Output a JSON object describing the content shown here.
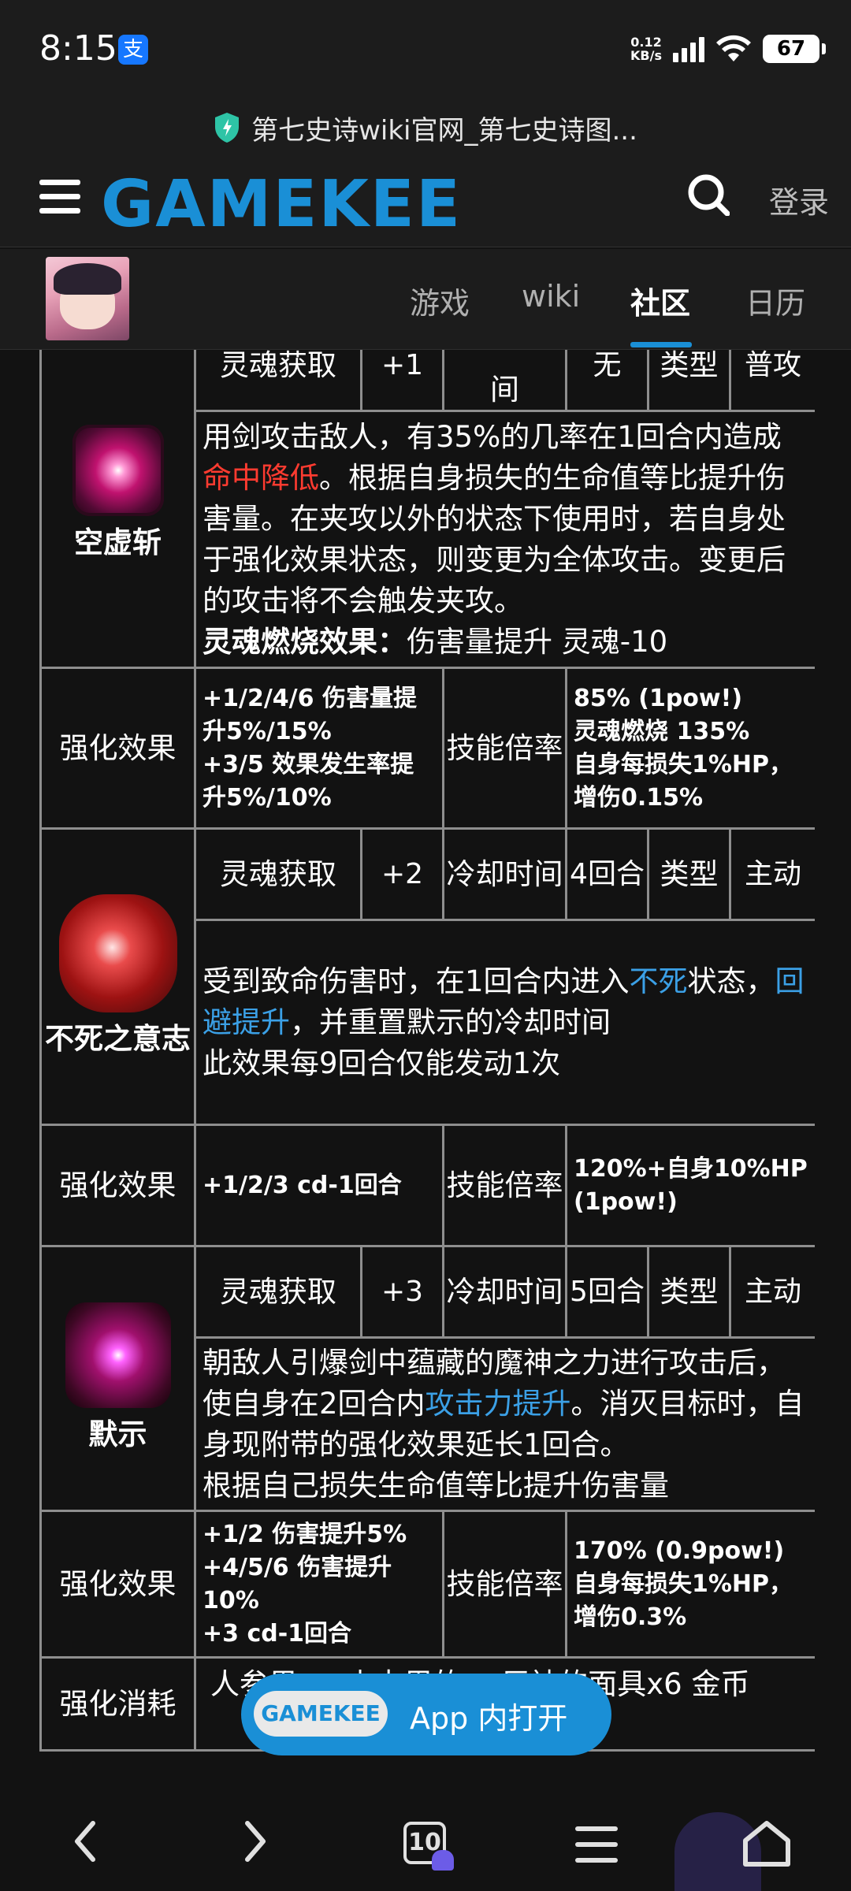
{
  "status_bar": {
    "time": "8:15",
    "alipay_glyph": "支",
    "net_speed_value": "0.12",
    "net_speed_unit": "KB/s",
    "battery": "67"
  },
  "url_bar": {
    "title": "第七史诗wiki官网_第七史诗图..."
  },
  "header": {
    "logo": "GAMEKEE",
    "login": "登录"
  },
  "nav": {
    "tabs": [
      "游戏",
      "wiki",
      "社区",
      "日历"
    ],
    "active": "社区"
  },
  "skills_table": {
    "top_row": {
      "soul_label": "灵魂获取",
      "soul_value": "+1",
      "cooldown_label_tail": "间",
      "cooldown_value": "无",
      "type_label": "类型",
      "type_value": "普攻"
    },
    "skill1": {
      "name": "空虚斩",
      "desc_1": "用剑攻击敌人，有35%的几率在1回合内造成",
      "desc_red": "命中降低",
      "desc_2": "。根据自身损失的生命值等比提升伤害量。在夹攻以外的状态下使用时，若自身处于强化效果状态，则变更为全体攻击。变更后的攻击将不会触发夹攻。",
      "soulburn_label": "灵魂燃烧效果：",
      "soulburn_text": "伤害量提升 灵魂-10",
      "enhance_label": "强化效果",
      "enhance_text_1": "+1/2/4/6 伤害量提升5%/15%",
      "enhance_text_2": "+3/5 效果发生率提升5%/10%",
      "multiplier_label": "技能倍率",
      "multiplier_1": "85% (1pow!)",
      "multiplier_2": "灵魂燃烧 135%",
      "multiplier_3": "自身每损失1%HP，增伤0.15%"
    },
    "skill2": {
      "name": "不死之意志",
      "soul_label": "灵魂获取",
      "soul_value": "+2",
      "cooldown_label": "冷却时间",
      "cooldown_value": "4回合",
      "type_label": "类型",
      "type_value": "主动",
      "desc_1": "受到致命伤害时，在1回合内进入",
      "desc_blue_1": "不死",
      "desc_2": "状态，",
      "desc_blue_2": "回避提升",
      "desc_3": "，并重置默示的冷却时间",
      "desc_4": "此效果每9回合仅能发动1次",
      "enhance_label": "强化效果",
      "enhance_text": "+1/2/3 cd-1回合",
      "multiplier_label": "技能倍率",
      "multiplier_text": "120%+自身10%HP (1pow!)"
    },
    "skill3": {
      "name": "默示",
      "soul_label": "灵魂获取",
      "soul_value": "+3",
      "cooldown_label": "冷却时间",
      "cooldown_value": "5回合",
      "type_label": "类型",
      "type_value": "主动",
      "desc_1": "朝敌人引爆剑中蕴藏的魔神之力进行攻击后，使自身在2回合内",
      "desc_blue": "攻击力提升",
      "desc_2": "。消灭目标时，自身现附带的强化效果延长1回合。",
      "desc_3": "根据自己损失生命值等比提升伤害量",
      "enhance_label": "强化效果",
      "enhance_text_1": "+1/2 伤害提升5%",
      "enhance_text_2": "+4/5/6 伤害提升10%",
      "enhance_text_3": "+3 cd-1回合",
      "multiplier_label": "技能倍率",
      "multiplier_1": "170% (0.9pow!)",
      "multiplier_2": "自身每损失1%HP，增伤0.3%"
    },
    "cost_row": {
      "label": "强化消耗",
      "text": "人参果 … 史卡里的… 巨神的面具x6 金币"
    }
  },
  "app_button": {
    "logo": "GAMEKEE",
    "label": "App 内打开"
  },
  "bottom_nav": {
    "tab_count": "10"
  },
  "colors": {
    "accent": "#1a8fd6",
    "red_text": "#ff3b30",
    "blue_text": "#3ba0e6",
    "background": "#121212",
    "border": "#8e8e8e"
  }
}
